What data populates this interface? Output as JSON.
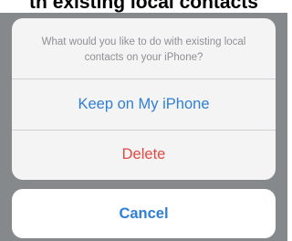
{
  "caption": {
    "text": "th existing local contacts"
  },
  "action_sheet": {
    "message": "What would you like to do with existing local contacts on your iPhone?",
    "actions": [
      {
        "label": "Keep on My iPhone",
        "color": "#2f7fd4"
      },
      {
        "label": "Delete",
        "color": "#e14a44"
      }
    ],
    "cancel_label": "Cancel"
  },
  "colors": {
    "backdrop": "#86898b",
    "accent": "#2f7fd4",
    "destructive": "#e14a44",
    "message_text": "#8f8f94"
  }
}
